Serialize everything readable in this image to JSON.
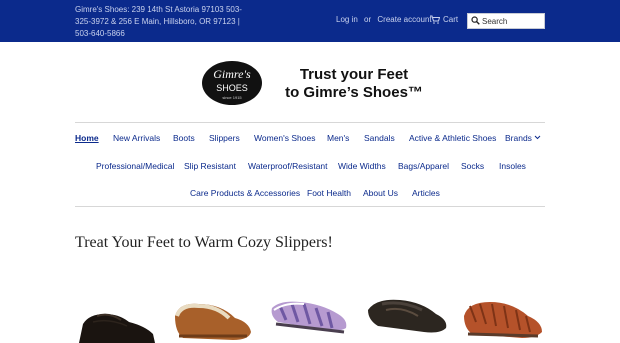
{
  "header": {
    "address": "Gimre's Shoes: 239 14th St Astoria 97103 503-325-3972 & 256 E Main, Hillsboro, OR 97123 | 503-640-5866",
    "login": "Log in",
    "or": "or",
    "create_account": "Create account",
    "cart": "Cart",
    "search_placeholder": "Search"
  },
  "brand": {
    "logo_text_top": "Gimre's",
    "logo_text_bottom": "SHOES",
    "logo_since": "since 1915",
    "tagline_line1": "Trust your Feet",
    "tagline_line2": "to Gimre’s Shoes™"
  },
  "nav": {
    "row1": [
      "Home",
      "New Arrivals",
      "Boots",
      "Slippers",
      "Women's Shoes",
      "Men's",
      "Sandals",
      "Active & Athletic Shoes",
      "Brands"
    ],
    "row2": [
      "Professional/Medical",
      "Slip Resistant",
      "Waterproof/Resistant",
      "Wide Widths",
      "Bags/Apparel",
      "Socks",
      "Insoles"
    ],
    "row3": [
      "Care Products & Accessories",
      "Foot Health",
      "About Us",
      "Articles"
    ]
  },
  "main": {
    "heading": "Treat Your Feet to Warm Cozy Slippers!"
  },
  "colors": {
    "topbar": "#0b2a8c",
    "link": "#0b2a8c"
  }
}
